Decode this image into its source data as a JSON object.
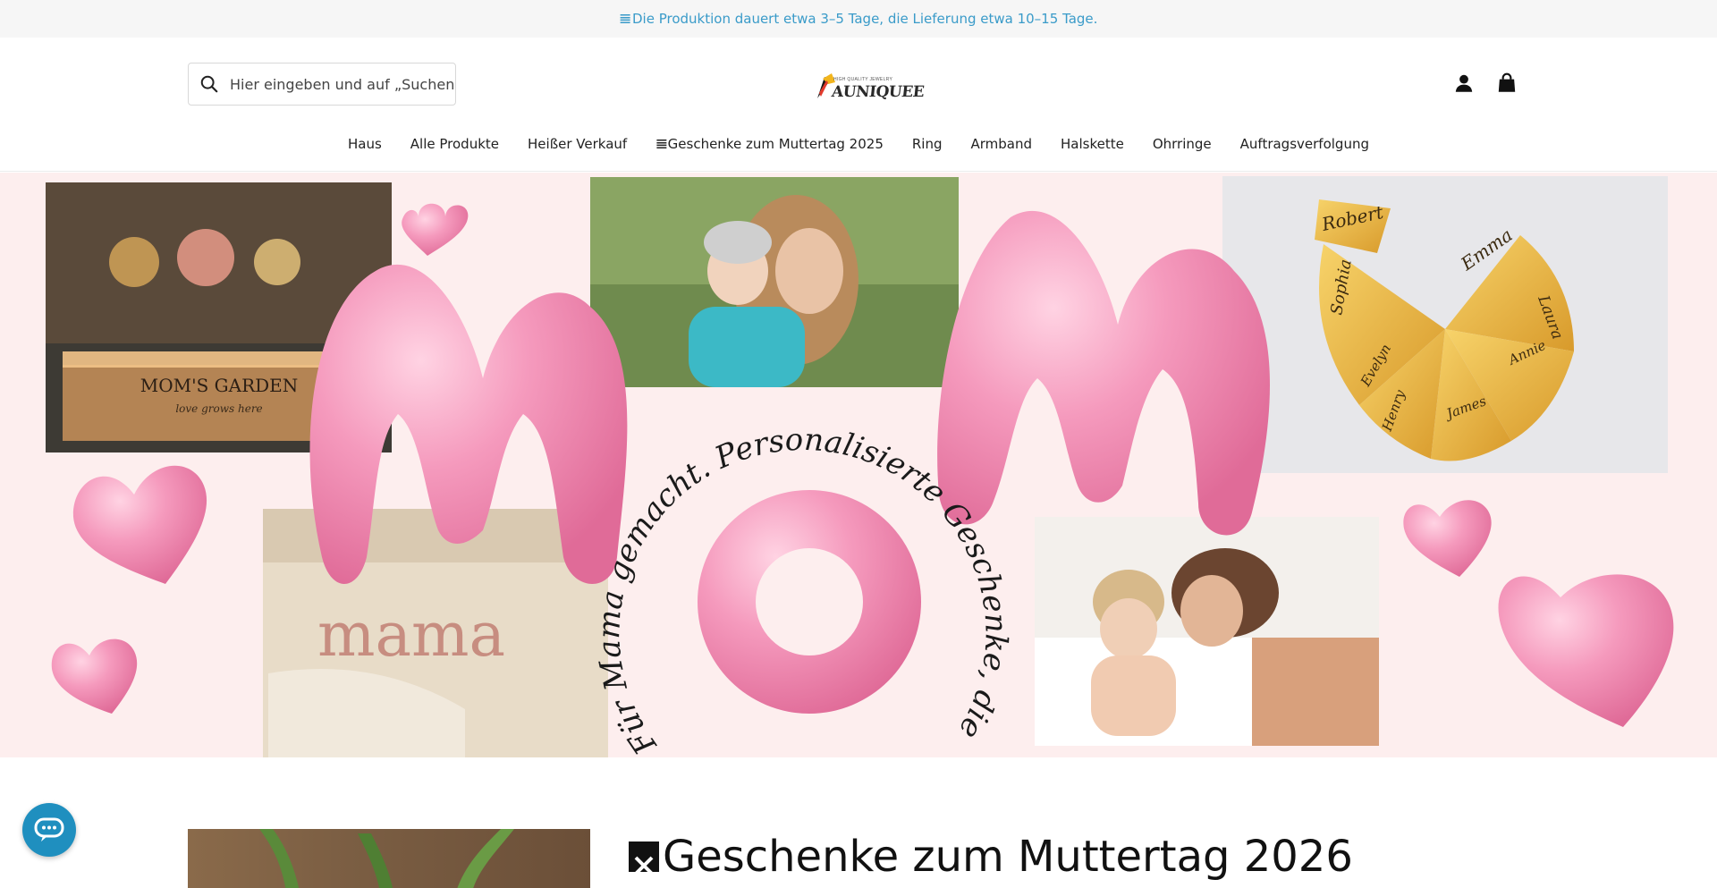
{
  "announcement": {
    "glyph": "𝌆",
    "text": "Die Produktion dauert etwa 3–5 Tage, die Lieferung etwa 10–15 Tage."
  },
  "search": {
    "placeholder": "Hier eingeben und auf „Suchen\" klicken"
  },
  "logo": {
    "text": "AUNIQUEE",
    "tagline": "HIGH QUALITY JEWELRY"
  },
  "nav": {
    "items": [
      "Haus",
      "Alle Produkte",
      "Heißer Verkauf",
      "𝌆Geschenke zum Muttertag 2025",
      "Ring",
      "Armband",
      "Halskette",
      "Ohrringe",
      "Auftragsverfolgung"
    ]
  },
  "hero": {
    "photo1_label": "MOM'S GARDEN",
    "photo1_sub": "love grows here",
    "curved_text": "Für Mama gemacht. Personalisierte Geschenke, die sie lieben wird.",
    "sweater_text": "mama",
    "puzzle_names": [
      "Robert",
      "Emma",
      "Sophia",
      "Laura",
      "Evelyn",
      "Annie",
      "Henry",
      "James"
    ]
  },
  "promo": {
    "title": "Geschenke zum Muttertag 2026"
  },
  "colors": {
    "accent": "#3a9bc9",
    "hero_bg": "#fdeeee",
    "chat": "#1f8fbf",
    "pink": "#f28fb4"
  }
}
